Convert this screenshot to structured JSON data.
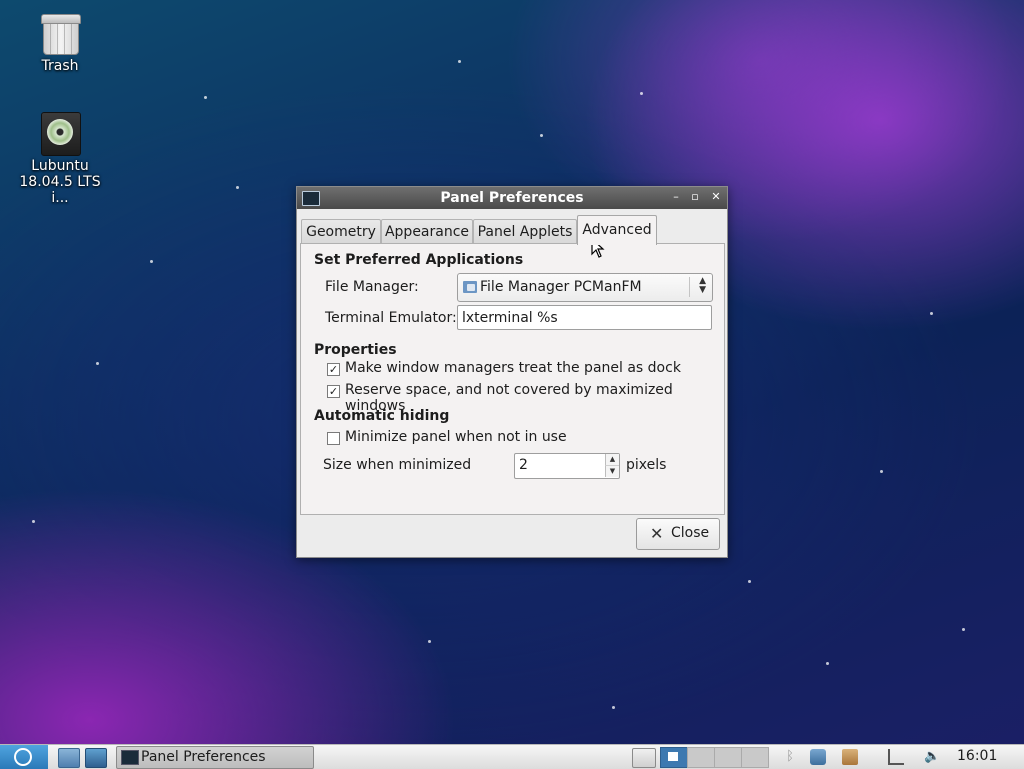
{
  "desktop": {
    "icons": [
      {
        "label": "Trash",
        "icon": "trash-icon"
      },
      {
        "label": "Lubuntu\n18.04.5 LTS i...",
        "icon": "disc-icon"
      }
    ]
  },
  "dialog": {
    "title": "Panel Preferences",
    "tabs": [
      {
        "label": "Geometry",
        "active": false
      },
      {
        "label": "Appearance",
        "active": false
      },
      {
        "label": "Panel Applets",
        "active": false
      },
      {
        "label": "Advanced",
        "active": true
      }
    ],
    "preferred": {
      "heading": "Set Preferred Applications",
      "file_manager_label": "File Manager:",
      "file_manager_value": "File Manager PCManFM",
      "terminal_label": "Terminal Emulator:",
      "terminal_value": "lxterminal %s"
    },
    "properties": {
      "heading": "Properties",
      "dock": {
        "label": "Make window managers treat the panel as dock",
        "checked": true
      },
      "reserve": {
        "label": "Reserve space, and not covered by maximized windows",
        "checked": true
      }
    },
    "autohide": {
      "heading": "Automatic hiding",
      "minimize": {
        "label": "Minimize panel when not in use",
        "checked": false
      },
      "size_label": "Size when minimized",
      "size_value": "2",
      "size_unit": "pixels"
    },
    "close_label": "Close"
  },
  "taskbar": {
    "task_label": "Panel Preferences",
    "clock": "16:01"
  },
  "colors": {
    "taskbar_menu": "#2b79b8",
    "active_workspace": "#3d79b0",
    "titlebar": "#4a4a4a"
  }
}
